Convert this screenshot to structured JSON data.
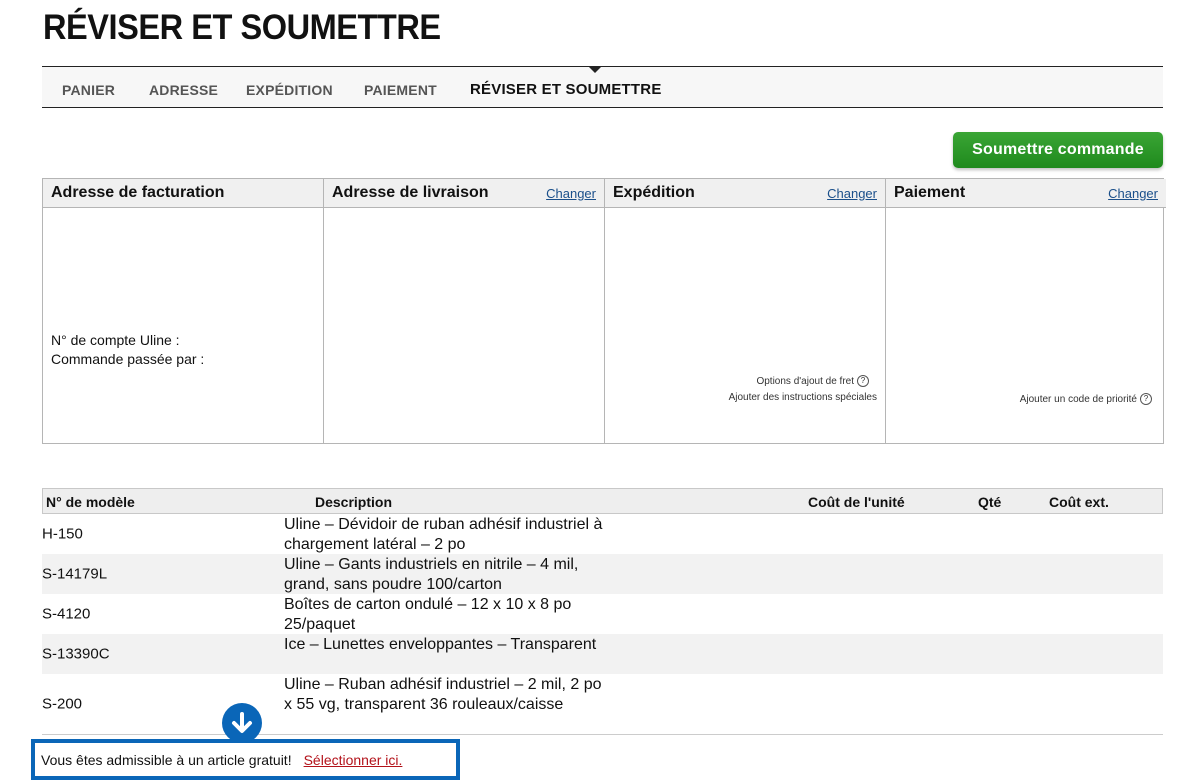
{
  "page": {
    "title": "RÉVISER ET SOUMETTRE"
  },
  "steps": [
    {
      "label": "PANIER"
    },
    {
      "label": "ADRESSE"
    },
    {
      "label": "EXPÉDITION"
    },
    {
      "label": "PAIEMENT"
    },
    {
      "label": "RÉVISER ET SOUMETTRE",
      "active": true
    }
  ],
  "submit_label": "Soumettre commande",
  "panels": {
    "billing": {
      "title": "Adresse de facturation",
      "account_label": "N° de compte Uline :",
      "ordered_by_label": "Commande passée par :"
    },
    "shipping_address": {
      "title": "Adresse de livraison",
      "change": "Changer"
    },
    "shipping": {
      "title": "Expédition",
      "change": "Changer",
      "freight_options": "Options d'ajout de fret",
      "special_instructions": "Ajouter des instructions spéciales"
    },
    "payment": {
      "title": "Paiement",
      "change": "Changer",
      "priority_code": "Ajouter un code de priorité"
    }
  },
  "table": {
    "headers": {
      "model": "N° de modèle",
      "description": "Description",
      "unit_cost": "Coût de l'unité",
      "qty": "Qté",
      "ext_cost": "Coût ext."
    },
    "rows": [
      {
        "model": "H-150",
        "description": "Uline – Dévidoir de ruban adhésif industriel à chargement latéral – 2 po"
      },
      {
        "model": "S-14179L",
        "description": "Uline – Gants industriels en nitrile – 4 mil, grand, sans poudre 100/carton"
      },
      {
        "model": "S-4120",
        "description": "Boîtes de carton ondulé – 12 x 10 x 8 po 25/paquet"
      },
      {
        "model": "S-13390C",
        "description": "Ice – Lunettes enveloppantes – Transparent"
      },
      {
        "model": "S-200",
        "description": "Uline – Ruban adhésif industriel – 2 mil, 2 po x 55 vg, transparent 36 rouleaux/caisse"
      }
    ]
  },
  "promo": {
    "text": "Vous êtes admissible à un article gratuit!",
    "link": "Sélectionner ici."
  },
  "icons": {
    "help": "question-circle-icon",
    "arrow": "arrow-down-circle-icon"
  },
  "colors": {
    "submit": "#2a9a27",
    "promo_border": "#0a66b8",
    "promo_link": "#b3121a",
    "change_link": "#1a4f8a"
  }
}
